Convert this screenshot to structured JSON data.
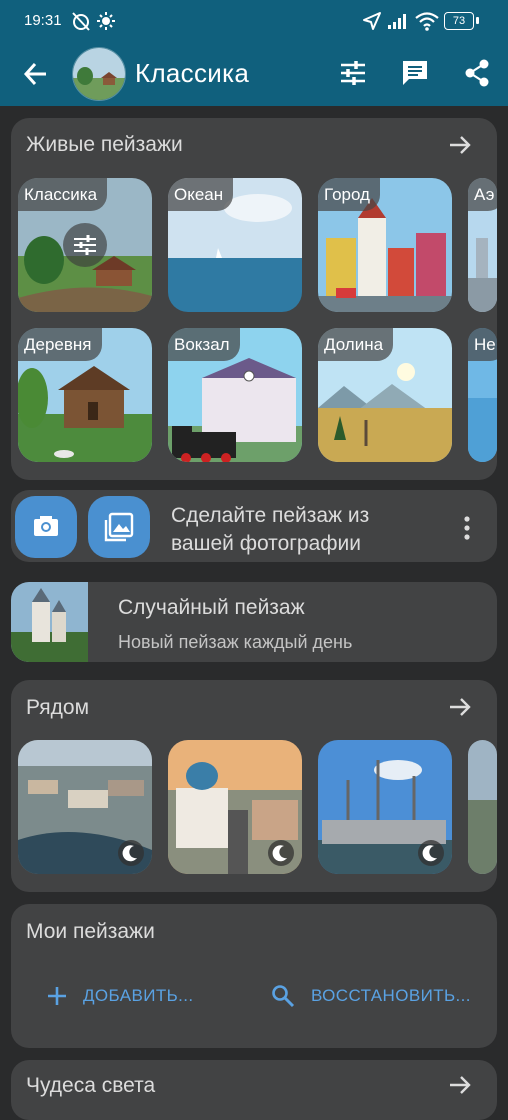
{
  "status": {
    "time": "19:31",
    "battery": "73"
  },
  "appbar": {
    "title": "Классика"
  },
  "live": {
    "title": "Живые пейзажи",
    "tiles": [
      "Классика",
      "Океан",
      "Город",
      "Аэ",
      "Деревня",
      "Вокзал",
      "Долина",
      "Не"
    ]
  },
  "photo": {
    "line1": "Сделайте пейзаж из",
    "line2": "вашей фотографии"
  },
  "random": {
    "title": "Случайный пейзаж",
    "subtitle": "Новый пейзаж каждый день"
  },
  "nearby": {
    "title": "Рядом"
  },
  "mine": {
    "title": "Мои пейзажи",
    "add": "ДОБАВИТЬ...",
    "restore": "ВОССТАНОВИТЬ..."
  },
  "wonders": {
    "title": "Чудеса света"
  },
  "colors": {
    "appbar": "#10607d",
    "card": "#424344",
    "accent": "#4a90d0",
    "link": "#5aa2e3"
  }
}
